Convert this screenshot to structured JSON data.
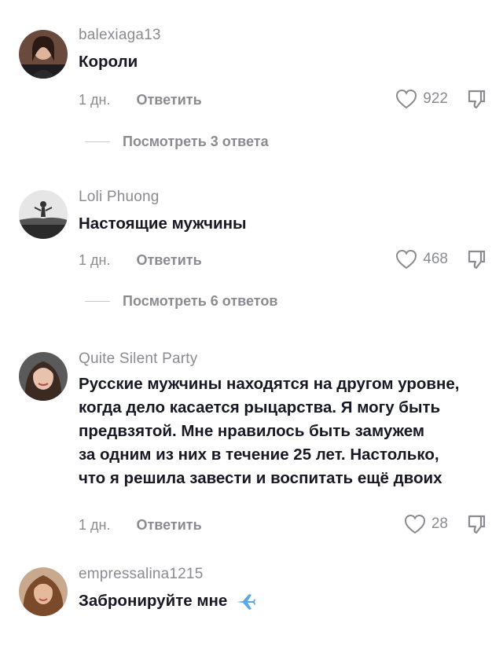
{
  "comments": [
    {
      "username": "balexiaga13",
      "text": "Короли",
      "time": "1 дн.",
      "reply_label": "Ответить",
      "likes": "922",
      "view_replies": "Посмотреть 3 ответа"
    },
    {
      "username": "Loli Phuong",
      "text": "Настоящие мужчины",
      "time": "1 дн.",
      "reply_label": "Ответить",
      "likes": "468",
      "view_replies": "Посмотреть 6 ответов"
    },
    {
      "username": "Quite Silent Party",
      "text_lines": [
        "Русские мужчины находятся на другом уровне,",
        "когда дело касается рыцарства. Я могу быть",
        "предвзятой. Мне нравилось быть замужем",
        "за одним из них в течение 25 лет. Настолько,",
        "что я решила завести и воспитать ещё двоих"
      ],
      "time": "1 дн.",
      "reply_label": "Ответить",
      "likes": "28"
    },
    {
      "username": "empressalina1215",
      "text": "Забронируйте мне"
    }
  ],
  "icons": {
    "like": "heart-outline-icon",
    "dislike": "thumbs-down-icon",
    "emoji": "airplane-emoji-icon"
  },
  "colors": {
    "text": "#161823",
    "muted": "#8a8b91",
    "divider": "#c9cacd",
    "plane": "#5aa9e6"
  }
}
